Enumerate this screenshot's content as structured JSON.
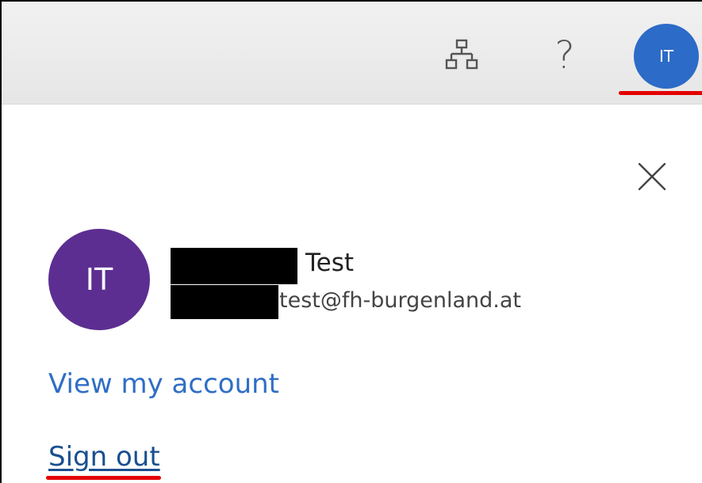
{
  "header": {
    "org_icon": "org-chart-icon",
    "help_label": "?",
    "me_initials": "IT"
  },
  "panel": {
    "close_icon": "close-icon",
    "avatar_initials": "IT",
    "user_name": "Test",
    "user_email": "test@fh-burgenland.at",
    "view_account_label": "View my account",
    "sign_out_label": "Sign out"
  },
  "colors": {
    "me_avatar": "#2c6bc7",
    "panel_avatar": "#5c2e91",
    "link": "#2f6ec6",
    "highlight": "#e40000"
  }
}
